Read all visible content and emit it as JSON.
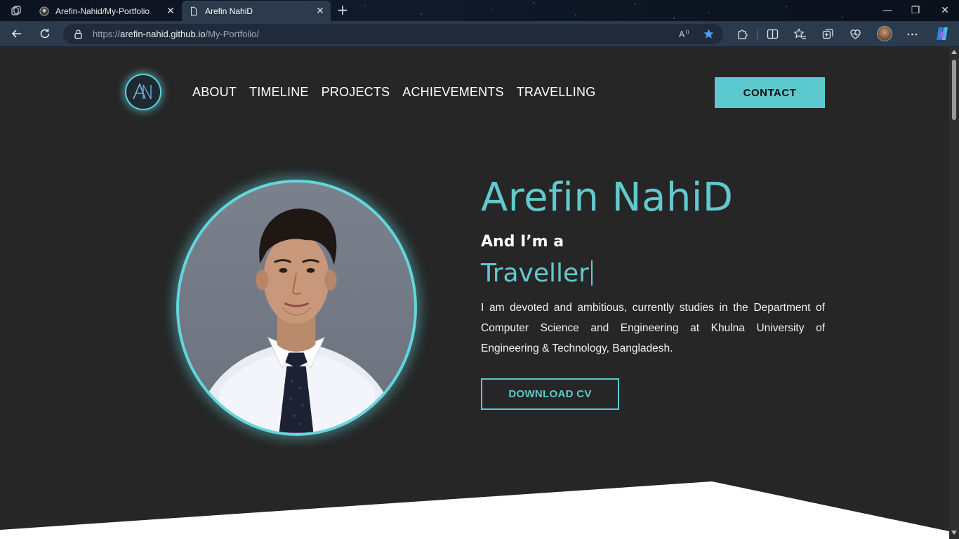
{
  "browser": {
    "tabs": [
      {
        "title": "Arefin-Nahid/My-Portfolio",
        "close": "✕"
      },
      {
        "title": "Arefin NahiD",
        "close": "✕"
      }
    ],
    "new_tab": "+",
    "window_controls": {
      "minimize": "—",
      "restore": "❐",
      "close": "✕"
    },
    "url": {
      "scheme": "https://",
      "host": "arefin-nahid.github.io",
      "path": "/My-Portfolio/"
    },
    "icons": [
      "tab-actions-icon",
      "github-icon",
      "page-icon",
      "back-icon",
      "refresh-icon",
      "lock-icon",
      "read-aloud-icon",
      "favorite-star-icon",
      "extensions-icon",
      "split-screen-icon",
      "favorites-icon",
      "collections-icon",
      "browser-essentials-icon",
      "profile-avatar",
      "more-icon",
      "copilot-icon"
    ]
  },
  "site": {
    "logo_text": "AN",
    "nav": [
      "ABOUT",
      "TIMELINE",
      "PROJECTS",
      "ACHIEVEMENTS",
      "TRAVELLING"
    ],
    "contact_label": "CONTACT",
    "hero": {
      "name": "Arefin NahiD",
      "intro": "And I’m a",
      "role": "Traveller",
      "bio": "I am devoted and ambitious, currently studies in the Department of Computer Science and Engineering at Khulna University of Engineering & Technology, Bangladesh.",
      "cv_label": "DOWNLOAD CV"
    }
  },
  "colors": {
    "accent": "#5cc9cf",
    "page_bg": "#262626",
    "chrome_bg": "#2b3a4c"
  }
}
